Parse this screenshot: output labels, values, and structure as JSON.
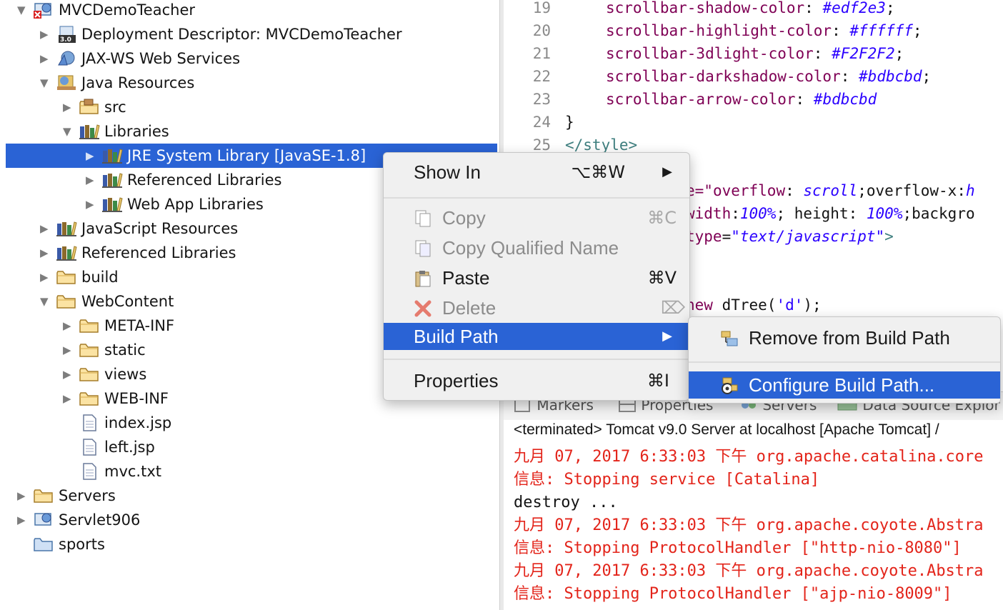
{
  "explorer": {
    "items": [
      {
        "label": "MVCDemoTeacher",
        "depth": 0,
        "twisty": "▼",
        "icon": "web-project-icon-error"
      },
      {
        "label": "Deployment Descriptor: MVCDemoTeacher",
        "depth": 1,
        "twisty": "▶",
        "icon": "deployment-descriptor-icon"
      },
      {
        "label": "JAX-WS Web Services",
        "depth": 1,
        "twisty": "▶",
        "icon": "web-services-icon"
      },
      {
        "label": "Java Resources",
        "depth": 1,
        "twisty": "▼",
        "icon": "java-resources-icon"
      },
      {
        "label": "src",
        "depth": 2,
        "twisty": "▶",
        "icon": "package-folder-icon"
      },
      {
        "label": "Libraries",
        "depth": 2,
        "twisty": "▼",
        "icon": "library-icon"
      },
      {
        "label": "JRE System Library [JavaSE-1.8]",
        "depth": 3,
        "twisty": "▶",
        "icon": "library-icon",
        "selected": true
      },
      {
        "label": "Referenced Libraries",
        "depth": 3,
        "twisty": "▶",
        "icon": "library-icon"
      },
      {
        "label": "Web App Libraries",
        "depth": 3,
        "twisty": "▶",
        "icon": "library-icon"
      },
      {
        "label": "JavaScript Resources",
        "depth": 1,
        "twisty": "▶",
        "icon": "library-icon"
      },
      {
        "label": "Referenced Libraries",
        "depth": 1,
        "twisty": "▶",
        "icon": "library-icon"
      },
      {
        "label": "build",
        "depth": 1,
        "twisty": "▶",
        "icon": "folder-icon"
      },
      {
        "label": "WebContent",
        "depth": 1,
        "twisty": "▼",
        "icon": "folder-icon"
      },
      {
        "label": "META-INF",
        "depth": 2,
        "twisty": "▶",
        "icon": "folder-icon"
      },
      {
        "label": "static",
        "depth": 2,
        "twisty": "▶",
        "icon": "folder-icon"
      },
      {
        "label": "views",
        "depth": 2,
        "twisty": "▶",
        "icon": "folder-icon"
      },
      {
        "label": "WEB-INF",
        "depth": 2,
        "twisty": "▶",
        "icon": "folder-icon"
      },
      {
        "label": "index.jsp",
        "depth": 2,
        "twisty": "",
        "icon": "file-icon"
      },
      {
        "label": "left.jsp",
        "depth": 2,
        "twisty": "",
        "icon": "file-icon"
      },
      {
        "label": "mvc.txt",
        "depth": 2,
        "twisty": "",
        "icon": "file-icon"
      },
      {
        "label": "Servers",
        "depth": 0,
        "twisty": "▶",
        "icon": "folder-icon"
      },
      {
        "label": "Servlet906",
        "depth": 0,
        "twisty": "▶",
        "icon": "web-project-icon"
      },
      {
        "label": "sports",
        "depth": 0,
        "twisty": "",
        "icon": "project-folder-icon"
      }
    ]
  },
  "editor": {
    "line_numbers": [
      "19",
      "20",
      "21",
      "22",
      "23",
      "24",
      "25"
    ],
    "css_lines": [
      {
        "prop": "scrollbar-shadow-color",
        "value": "#edf2e3"
      },
      {
        "prop": "scrollbar-highlight-color",
        "value": "#ffffff"
      },
      {
        "prop": "scrollbar-3dlight-color",
        "value": "#F2F2F2"
      },
      {
        "prop": "scrollbar-darkshadow-color",
        "value": "#bdbcbd"
      },
      {
        "prop": "scrollbar-arrow-color",
        "value": "#bdbcbd"
      }
    ],
    "close_brace": "}",
    "close_style": "</style>",
    "frag1": {
      "a": "e=\"",
      "b": "overflow",
      "c": ": ",
      "d": "scroll",
      "e": ";overflow-x:",
      "f": "h"
    },
    "frag2": {
      "a": "width",
      "b": ":",
      "c": "100%",
      "d": "; height: ",
      "e": "100%",
      "f": ";backgro"
    },
    "frag3": {
      "a": "type",
      "b": "=",
      "c": "\"text/javascript\"",
      "d": ">"
    },
    "frag4": {
      "a": "new",
      "b": " dTree(",
      "c": "'d'",
      "d": ");"
    }
  },
  "bottom_tabs": {
    "markers": "Markers",
    "properties": "Properties",
    "servers": "Servers",
    "datasource": "Data Source Explor"
  },
  "console": {
    "header": "<terminated> Tomcat v9.0 Server at localhost [Apache Tomcat] /",
    "lines": [
      {
        "text": "九月 07, 2017 6:33:03 下午 org.apache.catalina.core",
        "style": "red"
      },
      {
        "text": "信息: Stopping service [Catalina]",
        "style": "red"
      },
      {
        "text": "destroy ...",
        "style": "blk"
      },
      {
        "text": "九月 07, 2017 6:33:03 下午 org.apache.coyote.Abstra",
        "style": "red"
      },
      {
        "text": "信息: Stopping ProtocolHandler [\"http-nio-8080\"]",
        "style": "red"
      },
      {
        "text": "九月 07, 2017 6:33:03 下午 org.apache.coyote.Abstra",
        "style": "red"
      },
      {
        "text": "信息: Stopping ProtocolHandler [\"ajp-nio-8009\"]",
        "style": "red"
      }
    ]
  },
  "context_menu": {
    "show_in": {
      "label": "Show In",
      "shortcut": "⌥⌘W",
      "arrow": "▶"
    },
    "copy": {
      "label": "Copy",
      "shortcut": "⌘C"
    },
    "copy_qualified": {
      "label": "Copy Qualified Name"
    },
    "paste": {
      "label": "Paste",
      "shortcut": "⌘V"
    },
    "delete": {
      "label": "Delete",
      "shortcut": "⌦"
    },
    "build_path": {
      "label": "Build Path",
      "arrow": "▶"
    },
    "properties": {
      "label": "Properties",
      "shortcut": "⌘I"
    }
  },
  "submenu": {
    "remove": {
      "label": "Remove from Build Path"
    },
    "configure": {
      "label": "Configure Build Path..."
    }
  },
  "colors": {
    "selection": "#2a63d5",
    "css_property": "#7f0055",
    "css_value": "#2a00ff",
    "console_error": "#e3241a"
  }
}
